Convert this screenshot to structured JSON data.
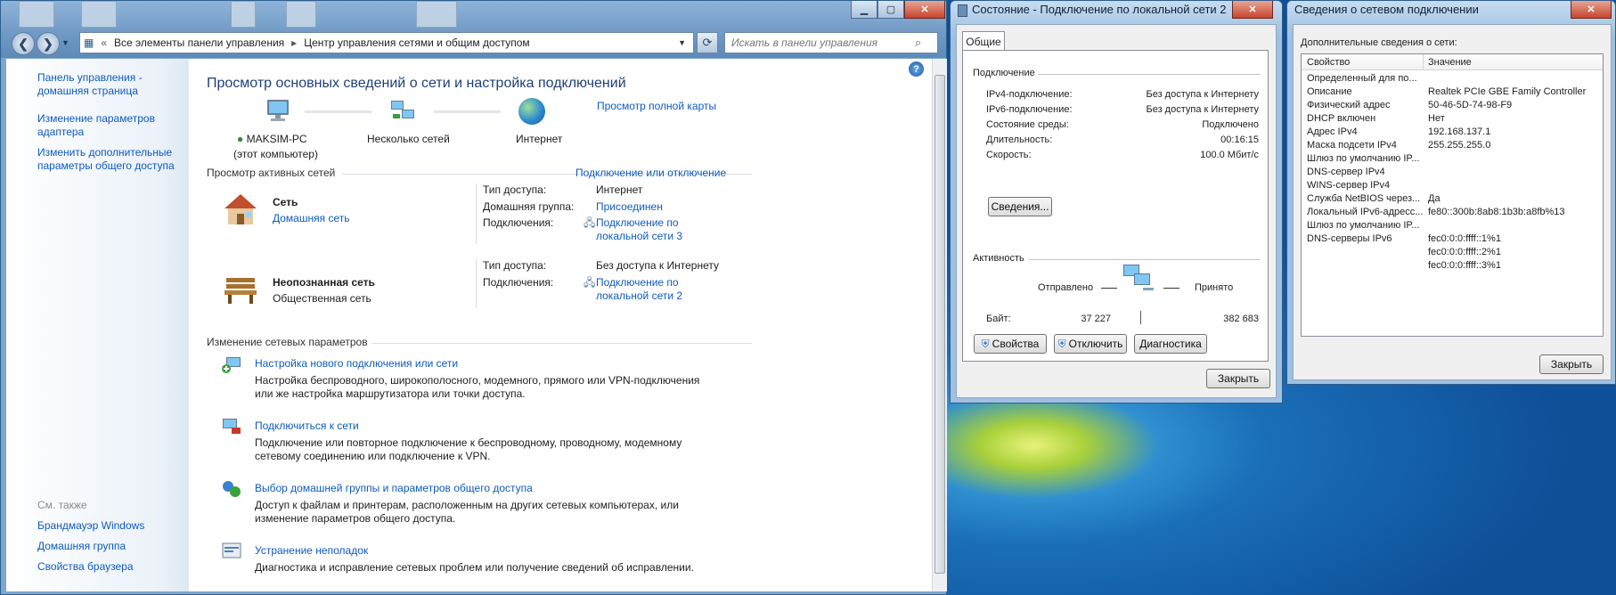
{
  "main_window": {
    "address": {
      "root": "Все элементы панели управления",
      "current": "Центр управления сетями и общим доступом"
    },
    "search_placeholder": "Искать в панели управления",
    "sidebar": {
      "items": [
        "Панель управления - домашняя страница",
        "Изменение параметров адаптера",
        "Изменить дополнительные параметры общего доступа"
      ],
      "see_also_title": "См. также",
      "see_also": [
        "Брандмауэр Windows",
        "Домашняя группа",
        "Свойства браузера"
      ]
    },
    "title": "Просмотр основных сведений о сети и настройка подключений",
    "full_map_link": "Просмотр полной карты",
    "map": {
      "computer": "MAKSIM-PC",
      "computer_sub": "(этот компьютер)",
      "networks": "Несколько сетей",
      "internet": "Интернет"
    },
    "active_networks_title": "Просмотр активных сетей",
    "connect_link": "Подключение или отключение",
    "networks": [
      {
        "name": "Сеть",
        "type": "Домашняя сеть",
        "access_label": "Тип доступа:",
        "access_value": "Интернет",
        "homegroup_label": "Домашняя группа:",
        "homegroup_value": "Присоединен",
        "conn_label": "Подключения:",
        "conn_value": "Подключение по\nлокальной сети 3"
      },
      {
        "name": "Неопознанная сеть",
        "type": "Общественная сеть",
        "access_label": "Тип доступа:",
        "access_value": "Без доступа к Интернету",
        "conn_label": "Подключения:",
        "conn_value": "Подключение по\nлокальной сети 2"
      }
    ],
    "change_title": "Изменение сетевых параметров",
    "tasks": [
      {
        "title": "Настройка нового подключения или сети",
        "desc": "Настройка беспроводного, широкополосного, модемного, прямого или VPN-подключения\nили же настройка маршрутизатора или точки доступа."
      },
      {
        "title": "Подключиться к сети",
        "desc": "Подключение или повторное подключение к беспроводному, проводному, модемному\nсетевому соединению или подключение к VPN."
      },
      {
        "title": "Выбор домашней группы и параметров общего доступа",
        "desc": "Доступ к файлам и принтерам, расположенным на других сетевых компьютерах, или\nизменение параметров общего доступа."
      },
      {
        "title": "Устранение неполадок",
        "desc": "Диагностика и исправление сетевых проблем или получение сведений об исправлении."
      }
    ]
  },
  "status_dialog": {
    "title": "Состояние - Подключение по локальной сети 2",
    "tab": "Общие",
    "connection_title": "Подключение",
    "rows": [
      {
        "label": "IPv4-подключение:",
        "value": "Без доступа к Интернету"
      },
      {
        "label": "IPv6-подключение:",
        "value": "Без доступа к Интернету"
      },
      {
        "label": "Состояние среды:",
        "value": "Подключено"
      },
      {
        "label": "Длительность:",
        "value": "00:16:15"
      },
      {
        "label": "Скорость:",
        "value": "100.0 Мбит/с"
      }
    ],
    "details_button": "Сведения...",
    "activity_title": "Активность",
    "sent_label": "Отправлено",
    "received_label": "Принято",
    "bytes_label": "Байт:",
    "bytes_sent": "37 227",
    "bytes_received": "382 683",
    "buttons": [
      "Свойства",
      "Отключить",
      "Диагностика"
    ],
    "close_button": "Закрыть"
  },
  "details_dialog": {
    "title": "Сведения о сетевом подключении",
    "subtitle": "Дополнительные сведения о сети:",
    "col_property": "Свойство",
    "col_value": "Значение",
    "rows": [
      {
        "p": "Определенный для по...",
        "v": ""
      },
      {
        "p": "Описание",
        "v": "Realtek PCIe GBE Family Controller"
      },
      {
        "p": "Физический адрес",
        "v": "50-46-5D-74-98-F9"
      },
      {
        "p": "DHCP включен",
        "v": "Нет"
      },
      {
        "p": "Адрес IPv4",
        "v": "192.168.137.1"
      },
      {
        "p": "Маска подсети IPv4",
        "v": "255.255.255.0"
      },
      {
        "p": "Шлюз по умолчанию IP...",
        "v": ""
      },
      {
        "p": "DNS-сервер IPv4",
        "v": ""
      },
      {
        "p": "WINS-сервер IPv4",
        "v": ""
      },
      {
        "p": "Служба NetBIOS через...",
        "v": "Да"
      },
      {
        "p": "Локальный IPv6-адресс...",
        "v": "fe80::300b:8ab8:1b3b:a8fb%13"
      },
      {
        "p": "Шлюз по умолчанию IP...",
        "v": ""
      },
      {
        "p": "DNS-серверы IPv6",
        "v": "fec0:0:0:ffff::1%1"
      },
      {
        "p": "",
        "v": "fec0:0:0:ffff::2%1"
      },
      {
        "p": "",
        "v": "fec0:0:0:ffff::3%1"
      }
    ],
    "close_button": "Закрыть"
  }
}
